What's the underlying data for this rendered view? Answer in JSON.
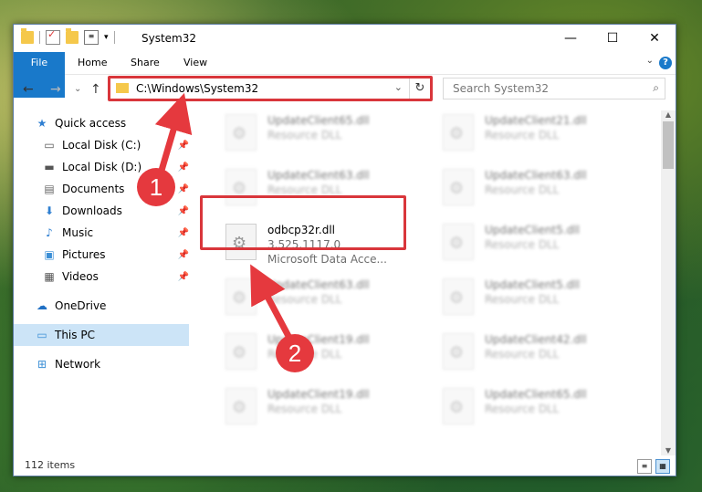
{
  "window": {
    "title": "System32",
    "controls": {
      "minimize": "—",
      "maximize": "☐",
      "close": "✕"
    }
  },
  "ribbon": {
    "tabs": [
      "File",
      "Home",
      "Share",
      "View"
    ],
    "help": "?"
  },
  "nav": {
    "back": "←",
    "forward": "→",
    "recent": "⌄",
    "up": "↑",
    "address": "C:\\Windows\\System32",
    "search_placeholder": "Search System32"
  },
  "sidebar": {
    "items": [
      {
        "label": "Quick access",
        "icon": "star-icon",
        "pinned": false
      },
      {
        "label": "Local Disk (C:)",
        "icon": "disk-icon",
        "pinned": true
      },
      {
        "label": "Local Disk (D:)",
        "icon": "disk-icon",
        "pinned": true
      },
      {
        "label": "Documents",
        "icon": "document-icon",
        "pinned": true
      },
      {
        "label": "Downloads",
        "icon": "download-icon",
        "pinned": true
      },
      {
        "label": "Music",
        "icon": "music-icon",
        "pinned": true
      },
      {
        "label": "Pictures",
        "icon": "pictures-icon",
        "pinned": true
      },
      {
        "label": "Videos",
        "icon": "videos-icon",
        "pinned": true
      },
      {
        "label": "OneDrive",
        "icon": "cloud-icon",
        "pinned": false
      },
      {
        "label": "This PC",
        "icon": "pc-icon",
        "pinned": false
      },
      {
        "label": "Network",
        "icon": "network-icon",
        "pinned": false
      }
    ]
  },
  "files": {
    "left": [
      {
        "name": "UpdateClient65.dll",
        "sub1": "Resource DLL"
      },
      {
        "name": "UpdateClient63.dll",
        "sub1": "Resource DLL"
      },
      {
        "name": "odbcp32r.dll",
        "sub1": "3.525.1117.0",
        "sub2": "Microsoft Data Acce..."
      },
      {
        "name": "UpdateClient63.dll",
        "sub1": "Resource DLL"
      },
      {
        "name": "UpdateClient19.dll",
        "sub1": "Resource DLL"
      },
      {
        "name": "UpdateClient19.dll",
        "sub1": "Resource DLL"
      }
    ],
    "right": [
      {
        "name": "UpdateClient21.dll",
        "sub1": "Resource DLL"
      },
      {
        "name": "UpdateClient63.dll",
        "sub1": "Resource DLL"
      },
      {
        "name": "UpdateClient5.dll",
        "sub1": "Resource DLL"
      },
      {
        "name": "UpdateClient5.dll",
        "sub1": "Resource DLL"
      },
      {
        "name": "UpdateClient42.dll",
        "sub1": "Resource DLL"
      },
      {
        "name": "UpdateClient65.dll",
        "sub1": "Resource DLL"
      }
    ]
  },
  "status": {
    "count": "112 items"
  },
  "callouts": [
    "1",
    "2"
  ],
  "colors": {
    "accent": "#1979ca",
    "highlight": "#d9363b"
  }
}
